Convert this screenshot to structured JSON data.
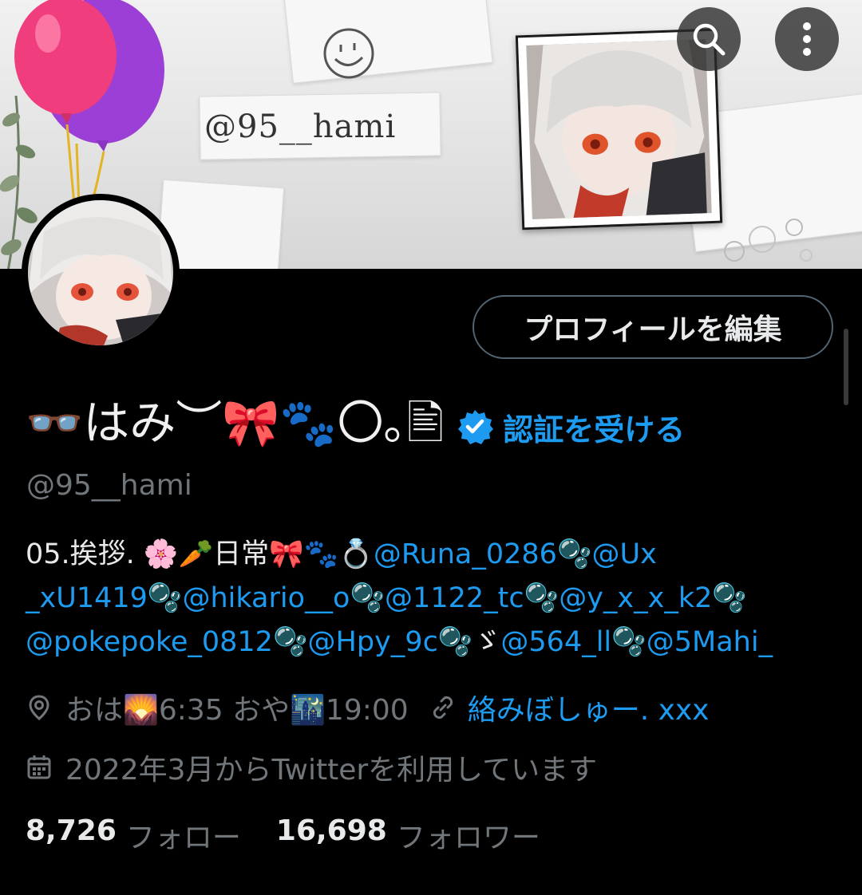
{
  "banner": {
    "handle_text": "@95__hami"
  },
  "profile": {
    "edit_label": "プロフィールを編集",
    "name": "👓はみ︶🎀🐾〇｡🖹",
    "get_verified": "認証を受ける",
    "handle": "@95__hami",
    "bio_lines": [
      [
        {
          "text": "05.挨拶. 🌸🥕日常🎀🐾💍",
          "type": "text"
        },
        {
          "text": "@Runa_0286",
          "type": "mention"
        },
        {
          "text": "🫧",
          "type": "text"
        },
        {
          "text": "@Ux",
          "type": "mention"
        }
      ],
      [
        {
          "text": "_xU1419",
          "type": "mention"
        },
        {
          "text": "🫧",
          "type": "text"
        },
        {
          "text": "@hikario__o",
          "type": "mention"
        },
        {
          "text": "🫧",
          "type": "text"
        },
        {
          "text": "@1122_tc",
          "type": "mention"
        },
        {
          "text": "🫧",
          "type": "text"
        },
        {
          "text": "@y_x_x_k2",
          "type": "mention"
        },
        {
          "text": "🫧",
          "type": "text"
        }
      ],
      [
        {
          "text": "@pokepoke_0812",
          "type": "mention"
        },
        {
          "text": "🫧",
          "type": "text"
        },
        {
          "text": "@Hpy_9c",
          "type": "mention"
        },
        {
          "text": "🫧ゞ",
          "type": "text"
        },
        {
          "text": "@564_ll",
          "type": "mention"
        },
        {
          "text": "🫧",
          "type": "text"
        },
        {
          "text": "@5Mahi_",
          "type": "mention"
        }
      ]
    ],
    "location": "おは🌄6:35 おや🌃19:00",
    "link": "絡みぼしゅー. xxx",
    "joined": "2022年3月からTwitterを利用しています",
    "following_count": "8,726",
    "following_label": "フォロー",
    "followers_count": "16,698",
    "followers_label": "フォロワー"
  },
  "icons": {
    "search": "search-icon",
    "more": "more-vertical-icon",
    "verified": "verified-badge-icon",
    "location": "location-pin-icon",
    "link": "link-icon",
    "calendar": "calendar-icon"
  },
  "colors": {
    "accent": "#1d9bf0",
    "muted": "#71767b",
    "text": "#e7e9ea",
    "background": "#000000"
  }
}
